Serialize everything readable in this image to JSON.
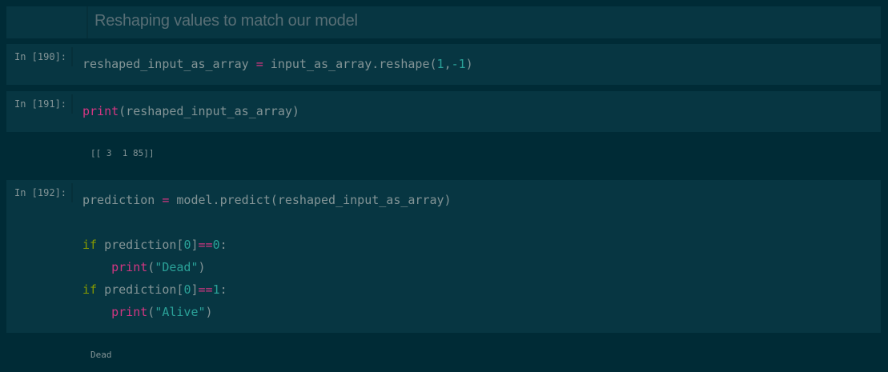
{
  "markdown": {
    "heading": "Reshaping values to match our model"
  },
  "cells": [
    {
      "prompt": "In [190]:",
      "lines": [
        [
          {
            "t": "reshaped_input_as_array ",
            "c": "plain"
          },
          {
            "t": "=",
            "c": "op"
          },
          {
            "t": " input_as_array.reshape(",
            "c": "plain"
          },
          {
            "t": "1",
            "c": "num"
          },
          {
            "t": ",",
            "c": "plain"
          },
          {
            "t": "-1",
            "c": "num"
          },
          {
            "t": ")",
            "c": "plain"
          }
        ]
      ]
    },
    {
      "prompt": "In [191]:",
      "lines": [
        [
          {
            "t": "print",
            "c": "kw"
          },
          {
            "t": "(reshaped_input_as_array)",
            "c": "plain"
          }
        ]
      ],
      "output": "[[ 3  1 85]]"
    },
    {
      "prompt": "In [192]:",
      "lines": [
        [
          {
            "t": "prediction ",
            "c": "plain"
          },
          {
            "t": "=",
            "c": "op"
          },
          {
            "t": " model.predict(reshaped_input_as_array)",
            "c": "plain"
          }
        ],
        [],
        [
          {
            "t": "if",
            "c": "kw2"
          },
          {
            "t": " prediction[",
            "c": "plain"
          },
          {
            "t": "0",
            "c": "num"
          },
          {
            "t": "]",
            "c": "plain"
          },
          {
            "t": "==",
            "c": "op"
          },
          {
            "t": "0",
            "c": "num"
          },
          {
            "t": ":",
            "c": "plain"
          }
        ],
        [
          {
            "t": "    ",
            "c": "plain"
          },
          {
            "t": "print",
            "c": "kw"
          },
          {
            "t": "(",
            "c": "plain"
          },
          {
            "t": "\"Dead\"",
            "c": "str"
          },
          {
            "t": ")",
            "c": "plain"
          }
        ],
        [
          {
            "t": "if",
            "c": "kw2"
          },
          {
            "t": " prediction[",
            "c": "plain"
          },
          {
            "t": "0",
            "c": "num"
          },
          {
            "t": "]",
            "c": "plain"
          },
          {
            "t": "==",
            "c": "op"
          },
          {
            "t": "1",
            "c": "num"
          },
          {
            "t": ":",
            "c": "plain"
          }
        ],
        [
          {
            "t": "    ",
            "c": "plain"
          },
          {
            "t": "print",
            "c": "kw"
          },
          {
            "t": "(",
            "c": "plain"
          },
          {
            "t": "\"Alive\"",
            "c": "str"
          },
          {
            "t": ")",
            "c": "plain"
          }
        ]
      ],
      "output": "Dead"
    }
  ],
  "colors": {
    "background": "#002b36",
    "cell": "#073642",
    "keyword": "#d33682",
    "control": "#859900",
    "number": "#2aa198",
    "text": "#839496"
  }
}
